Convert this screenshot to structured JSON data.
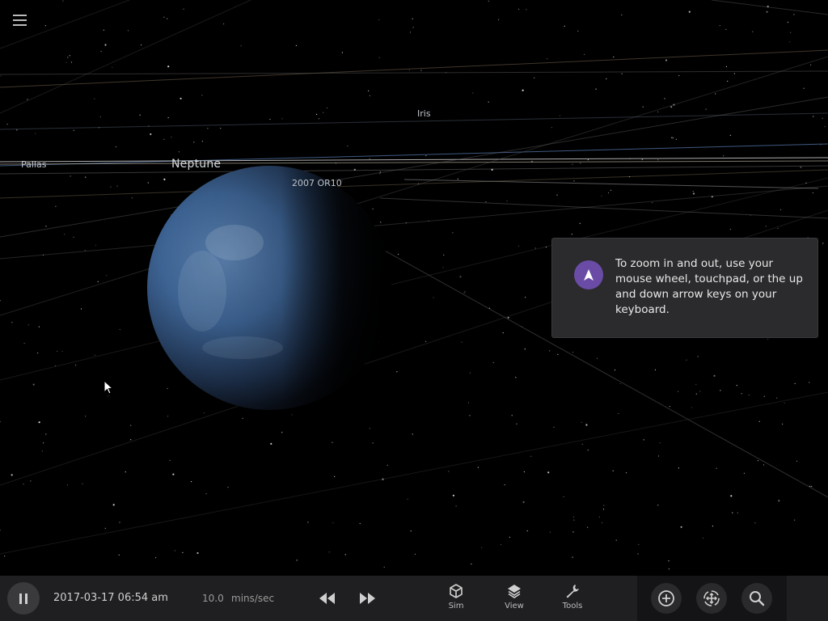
{
  "scene": {
    "labels": [
      {
        "key": "pallas",
        "text": "Pallas"
      },
      {
        "key": "neptune",
        "text": "Neptune"
      },
      {
        "key": "iris",
        "text": "Iris"
      },
      {
        "key": "or10",
        "text": "2007 OR10"
      }
    ]
  },
  "toast": {
    "icon": "navigation-arrow-icon",
    "message": "To zoom in and out, use your mouse wheel, touchpad, or the up and down arrow keys on your keyboard.",
    "accent": "#6a4ca6"
  },
  "bottom_bar": {
    "date": "2017-03-17 06:54 am",
    "rate_value": "10.0",
    "rate_unit": "mins/sec",
    "nav": [
      {
        "label": "Sim",
        "icon": "cube-icon"
      },
      {
        "label": "View",
        "icon": "layers-icon"
      },
      {
        "label": "Tools",
        "icon": "wrench-icon"
      }
    ],
    "right_icons": [
      "zoom-in-icon",
      "recenter-icon",
      "search-icon"
    ]
  }
}
